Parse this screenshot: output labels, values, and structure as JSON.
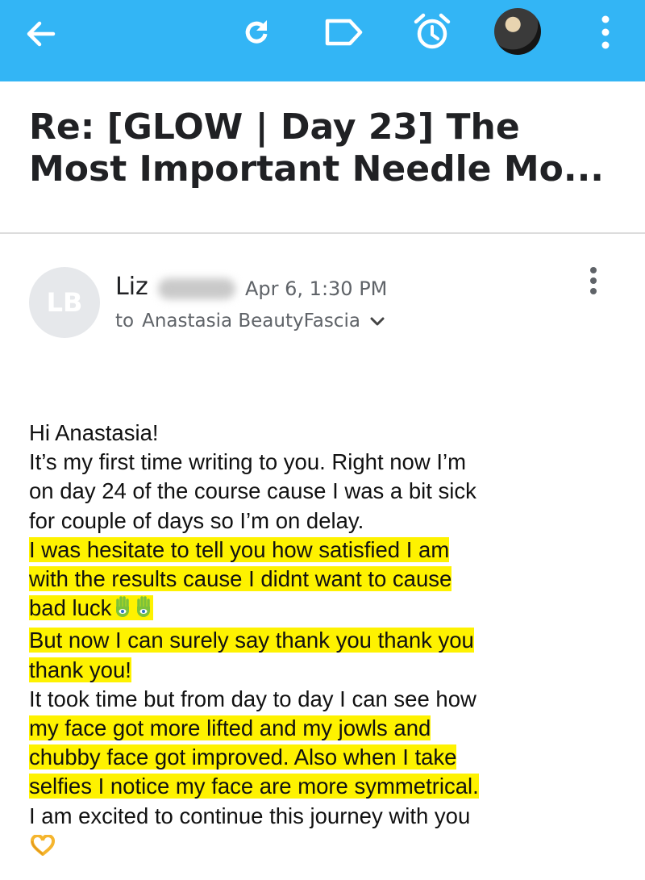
{
  "toolbar": {
    "back_icon": "arrow-left-icon",
    "refresh_icon": "refresh-icon",
    "label_icon": "label-icon",
    "snooze_icon": "alarm-clock-icon",
    "more_icon": "more-vertical-icon",
    "accent_color": "#33b5f5"
  },
  "email": {
    "subject_line1": "Re: [GLOW | Day 23] The",
    "subject_line2": "Most Important Needle Mo...",
    "sender": {
      "initials": "LB",
      "first_name": "Liz",
      "date": "Apr 6, 1:30 PM"
    },
    "recipient_prefix": "to",
    "recipient_name": "Anastasia BeautyFascia",
    "body": {
      "l1": "Hi Anastasia!",
      "l2": "It’s my first time writing to you. Right now I’m",
      "l3": "on day 24 of the course cause I was a bit sick",
      "l4": "for couple of days so I’m  on delay.",
      "l5": "I was hesitate to tell you how satisfied I am",
      "l6": "with the results cause I didnt want to cause",
      "l7": "bad luck",
      "l8": "But now I can surely say thank you thank you",
      "l9": "thank you!",
      "l10": "It took time but from day to day I can see how",
      "l11": "my face got more lifted and my jowls and",
      "l12": "chubby face got improved. Also when I take",
      "l13": "selfies I notice my face are more symmetrical.",
      "l14": "I am excited to continue this journey with you"
    },
    "highlight_color": "#fef200"
  }
}
